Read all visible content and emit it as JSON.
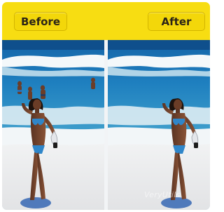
{
  "labels": {
    "before": "Before",
    "after": "After"
  },
  "watermark": "VeryUtils",
  "colors": {
    "header": "#f7dd12",
    "button": "#f3d70a",
    "ocean": "#1e78b6",
    "sand": "#e9e9ea",
    "swimsuit": "#2f86c9"
  }
}
